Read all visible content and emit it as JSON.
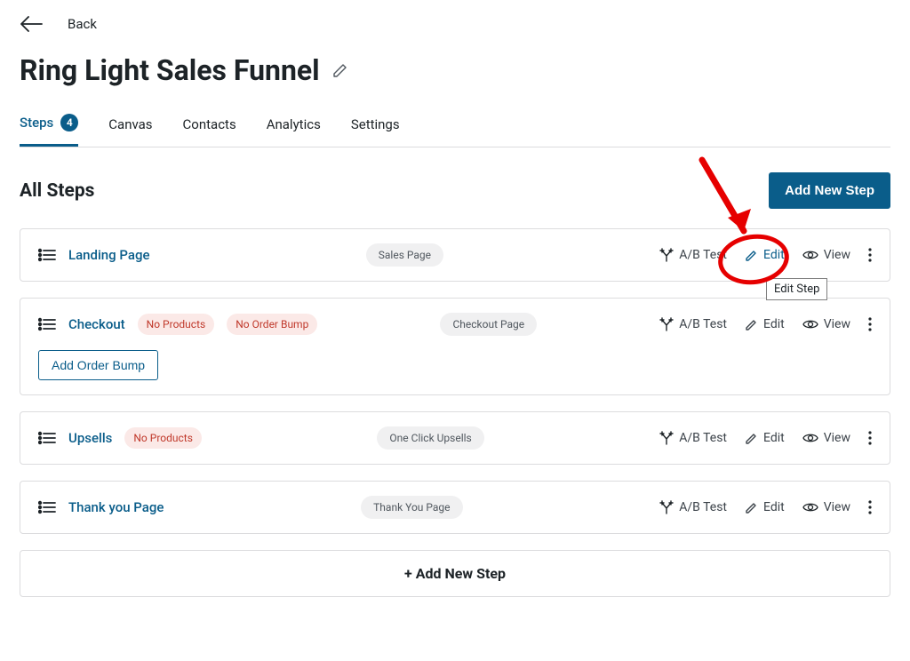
{
  "back": {
    "label": "Back"
  },
  "title": "Ring Light Sales Funnel",
  "tabs": [
    {
      "label": "Steps",
      "count": "4",
      "active": true
    },
    {
      "label": "Canvas"
    },
    {
      "label": "Contacts"
    },
    {
      "label": "Analytics"
    },
    {
      "label": "Settings"
    }
  ],
  "section": {
    "title": "All Steps",
    "add_button": "Add New Step"
  },
  "row_actions": {
    "abtest": "A/B Test",
    "edit": "Edit",
    "view": "View"
  },
  "steps": [
    {
      "name": "Landing Page",
      "type": "Sales Page",
      "warnings": []
    },
    {
      "name": "Checkout",
      "type": "Checkout Page",
      "warnings": [
        "No Products",
        "No Order Bump"
      ],
      "add_bump": "Add Order Bump"
    },
    {
      "name": "Upsells",
      "type": "One Click Upsells",
      "warnings": [
        "No Products"
      ]
    },
    {
      "name": "Thank you Page",
      "type": "Thank You Page",
      "warnings": []
    }
  ],
  "add_step_full": "+ Add New Step",
  "tooltip": "Edit Step"
}
